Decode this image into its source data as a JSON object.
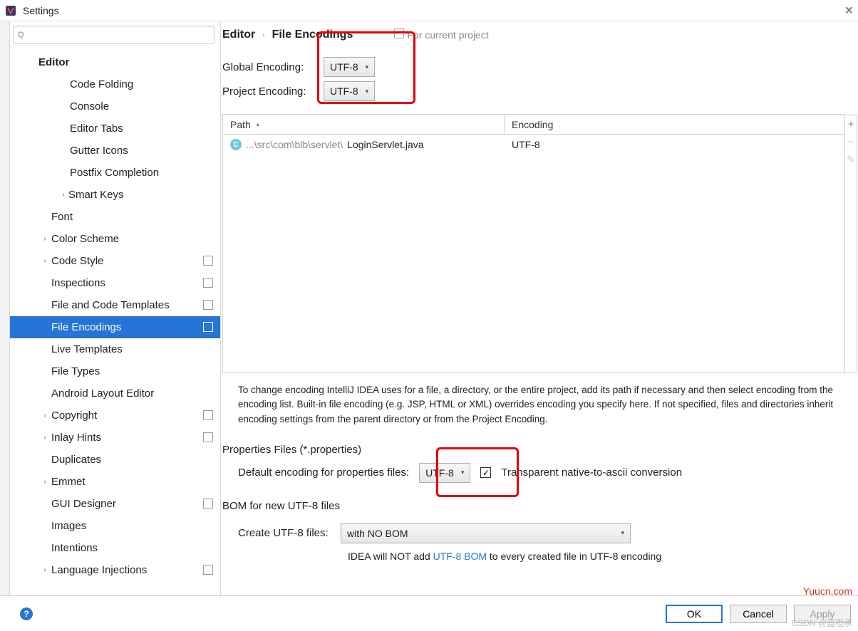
{
  "window": {
    "title": "Settings"
  },
  "search": {
    "placeholder": ""
  },
  "sidebar": {
    "items": [
      {
        "label": "Editor",
        "depth": 0,
        "arrow": "",
        "icon": false
      },
      {
        "label": "Code Folding",
        "depth": 2,
        "arrow": "",
        "icon": false
      },
      {
        "label": "Console",
        "depth": 2,
        "arrow": "",
        "icon": false
      },
      {
        "label": "Editor Tabs",
        "depth": 2,
        "arrow": "",
        "icon": false
      },
      {
        "label": "Gutter Icons",
        "depth": 2,
        "arrow": "",
        "icon": false
      },
      {
        "label": "Postfix Completion",
        "depth": 2,
        "arrow": "",
        "icon": false
      },
      {
        "label": "Smart Keys",
        "depth": 2,
        "arrow": "›",
        "icon": false,
        "hasArrow": true,
        "pad": "68px"
      },
      {
        "label": "Font",
        "depth": 1,
        "arrow": "",
        "icon": false
      },
      {
        "label": "Color Scheme",
        "depth": 1,
        "arrow": "›",
        "icon": false,
        "hasArrow": true
      },
      {
        "label": "Code Style",
        "depth": 1,
        "arrow": "›",
        "icon": true,
        "hasArrow": true
      },
      {
        "label": "Inspections",
        "depth": 1,
        "arrow": "",
        "icon": true
      },
      {
        "label": "File and Code Templates",
        "depth": 1,
        "arrow": "",
        "icon": true
      },
      {
        "label": "File Encodings",
        "depth": 1,
        "arrow": "",
        "icon": true,
        "selected": true
      },
      {
        "label": "Live Templates",
        "depth": 1,
        "arrow": "",
        "icon": false
      },
      {
        "label": "File Types",
        "depth": 1,
        "arrow": "",
        "icon": false
      },
      {
        "label": "Android Layout Editor",
        "depth": 1,
        "arrow": "",
        "icon": false
      },
      {
        "label": "Copyright",
        "depth": 1,
        "arrow": "›",
        "icon": true,
        "hasArrow": true
      },
      {
        "label": "Inlay Hints",
        "depth": 1,
        "arrow": "›",
        "icon": true,
        "hasArrow": true
      },
      {
        "label": "Duplicates",
        "depth": 1,
        "arrow": "",
        "icon": false
      },
      {
        "label": "Emmet",
        "depth": 1,
        "arrow": "›",
        "icon": false,
        "hasArrow": true
      },
      {
        "label": "GUI Designer",
        "depth": 1,
        "arrow": "",
        "icon": true
      },
      {
        "label": "Images",
        "depth": 1,
        "arrow": "",
        "icon": false
      },
      {
        "label": "Intentions",
        "depth": 1,
        "arrow": "",
        "icon": false
      },
      {
        "label": "Language Injections",
        "depth": 1,
        "arrow": "›",
        "icon": true,
        "hasArrow": true
      }
    ]
  },
  "breadcrumb": {
    "a": "Editor",
    "b": "File Encodings",
    "project": "For current project"
  },
  "encodings": {
    "global_label": "Global Encoding:",
    "global_value": "UTF-8",
    "project_label": "Project Encoding:",
    "project_value": "UTF-8"
  },
  "table": {
    "path_header": "Path",
    "encoding_header": "Encoding",
    "rows": [
      {
        "prefix": "...\\src\\com\\blb\\servlet\\",
        "name": "LoginServlet.java",
        "encoding": "UTF-8"
      }
    ]
  },
  "description": "To change encoding IntelliJ IDEA uses for a file, a directory, or the entire project, add its path if necessary and then select encoding from the encoding list. Built-in file encoding (e.g. JSP, HTML or XML) overrides encoding you specify here. If not specified, files and directories inherit encoding settings from the parent directory or from the Project Encoding.",
  "properties": {
    "heading": "Properties Files (*.properties)",
    "label": "Default encoding for properties files:",
    "value": "UTF-8",
    "checkbox_label": "Transparent native-to-ascii conversion"
  },
  "bom": {
    "heading": "BOM for new UTF-8 files",
    "label": "Create UTF-8 files:",
    "value": "with NO BOM",
    "note_pre": "IDEA will NOT add ",
    "note_link": "UTF-8 BOM",
    "note_post": " to every created file in UTF-8 encoding"
  },
  "buttons": {
    "ok": "OK",
    "cancel": "Cancel",
    "apply": "Apply"
  },
  "watermarks": {
    "w1": "Yuucn.com",
    "w2": "CSDN @蓝橙承"
  }
}
